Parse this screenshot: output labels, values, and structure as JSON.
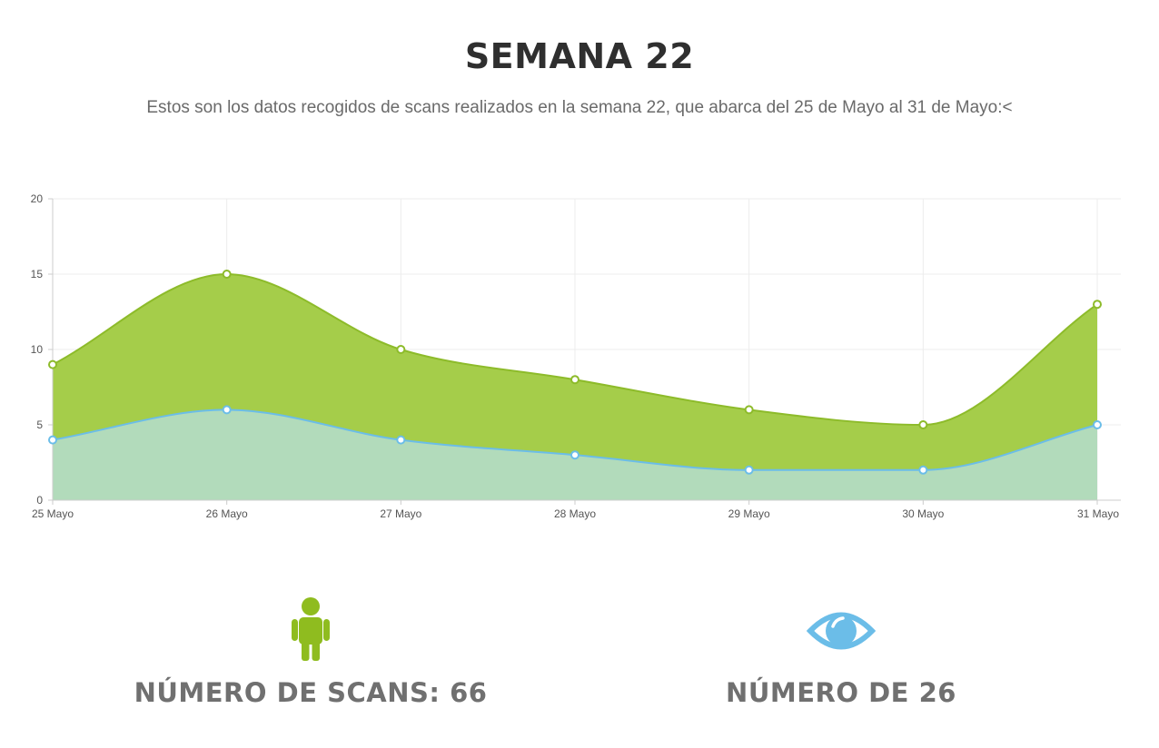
{
  "header": {
    "title": "SEMANA 22",
    "subtitle": "Estos son los datos recogidos de scans realizados en la semana 22, que abarca del 25 de Mayo al 31 de Mayo:<"
  },
  "chart_data": {
    "type": "area",
    "categories": [
      "25 Mayo",
      "26 Mayo",
      "27 Mayo",
      "28 Mayo",
      "29 Mayo",
      "30 Mayo",
      "31 Mayo"
    ],
    "series": [
      {
        "values": [
          9,
          15,
          10,
          8,
          6,
          5,
          13
        ],
        "color": "#a5cd4a",
        "line_color": "#8dbb2a"
      },
      {
        "values": [
          4,
          6,
          4,
          3,
          2,
          2,
          5
        ],
        "color": "#b2dbbb",
        "line_color": "#6bbde8"
      }
    ],
    "ylim": [
      0,
      20
    ],
    "yticks": [
      "0",
      "5",
      "10",
      "15",
      "20"
    ],
    "grid": true,
    "smooth": true
  },
  "stats": {
    "scans": {
      "label": "NÚMERO DE SCANS: 66",
      "icon": "person-icon",
      "color": "#8fbc1f"
    },
    "views": {
      "label": "NÚMERO DE 26",
      "icon": "eye-icon",
      "color": "#6bbde8"
    }
  }
}
